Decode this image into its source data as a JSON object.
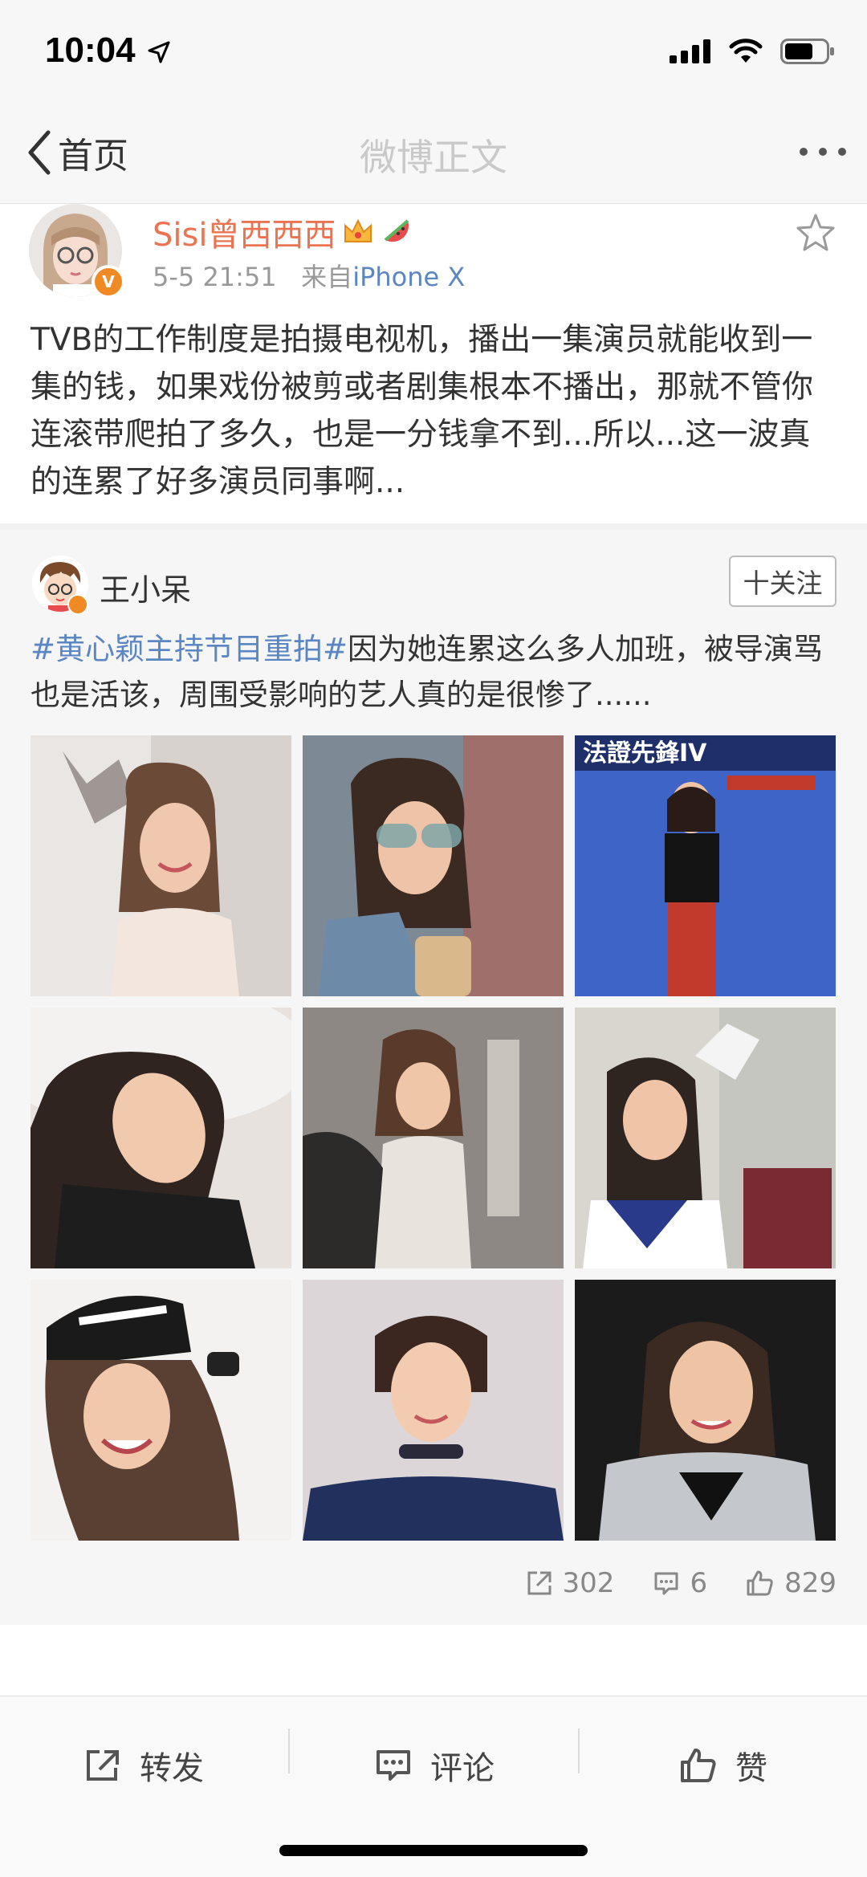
{
  "status_bar": {
    "time": "10:04"
  },
  "nav": {
    "back_label": "首页",
    "title": "微博正文"
  },
  "post": {
    "username": "Sisi曾西西西",
    "time": "5-5 21:51",
    "source_prefix": "来自",
    "source": "iPhone X",
    "text": "TVB的工作制度是拍摄电视机，播出一集演员就能收到一集的钱，如果戏份被剪或者剧集根本不播出，那就不管你连滚带爬拍了多久，也是一分钱拿不到...所以...这一波真的连累了好多演员同事啊..."
  },
  "repost": {
    "username": "王小呆",
    "follow_label": "十关注",
    "hashtag": "#黄心颖主持节目重拍#",
    "text": "因为她连累这么多人加班，被导演骂也是活该，周围受影响的艺人真的是很惨了......",
    "photos": [
      {
        "caption": ""
      },
      {
        "caption": ""
      },
      {
        "caption": "法證先鋒IV"
      },
      {
        "caption": ""
      },
      {
        "caption": ""
      },
      {
        "caption": ""
      },
      {
        "caption": ""
      },
      {
        "caption": ""
      },
      {
        "caption": ""
      }
    ],
    "stats": {
      "reposts": "302",
      "comments": "6",
      "likes": "829"
    }
  },
  "toolbar": {
    "repost": "转发",
    "comment": "评论",
    "like": "赞"
  },
  "colors": {
    "username": "#eb7350",
    "link": "#5b86c4",
    "badge": "#f08a24"
  }
}
